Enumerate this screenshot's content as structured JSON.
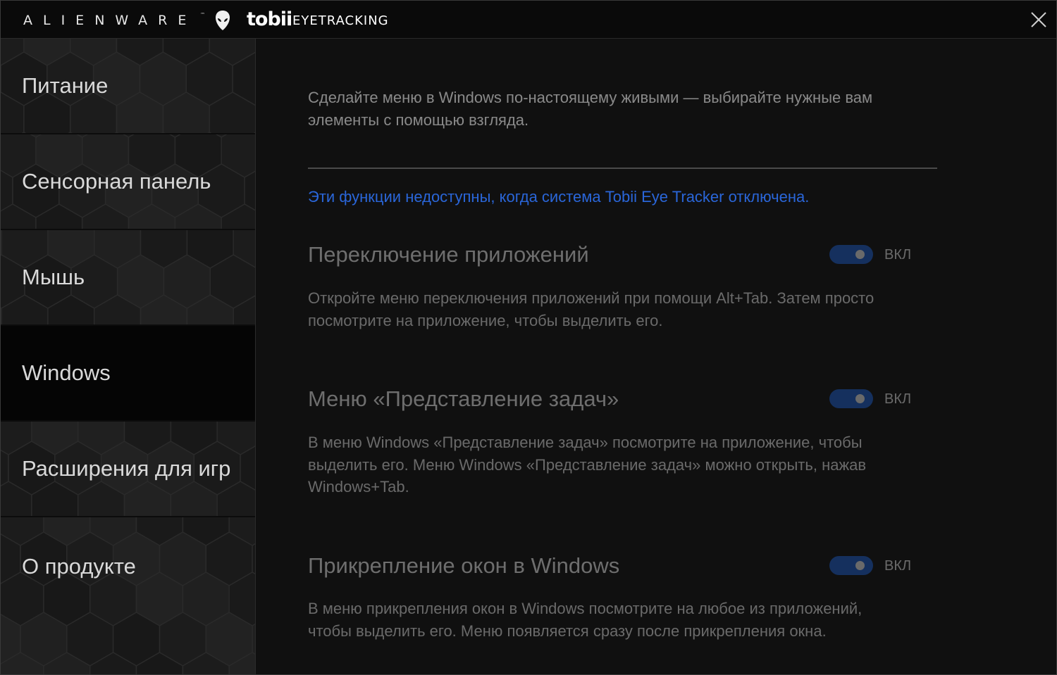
{
  "titlebar": {
    "brand_alienware": "ALIENWARE",
    "brand_tm": "™",
    "brand_tobii": "tobii",
    "brand_eyetracking": "EYETRACKING",
    "close_icon": "close-icon"
  },
  "sidebar": {
    "items": [
      {
        "label": "Питание"
      },
      {
        "label": "Сенсорная панель"
      },
      {
        "label": "Мышь"
      },
      {
        "label": "Windows"
      },
      {
        "label": "Расширения для игр"
      },
      {
        "label": "О продукте"
      }
    ],
    "active_index": 3
  },
  "main": {
    "intro": "Сделайте меню в Windows по-настоящему живыми — выбирайте нужные вам элементы с помощью взгляда.",
    "notice": "Эти функции недоступны, когда система Tobii Eye Tracker отключена.",
    "features": [
      {
        "title": "Переключение приложений",
        "toggle_label": "ВКЛ",
        "toggle_on": true,
        "description": "Откройте меню переключения приложений при помощи Alt+Tab. Затем просто посмотрите на приложение, чтобы выделить его."
      },
      {
        "title": "Меню «Представление задач»",
        "toggle_label": "ВКЛ",
        "toggle_on": true,
        "description": "В меню Windows «Представление задач» посмотрите на приложение, чтобы выделить его. Меню Windows «Представление задач» можно открыть, нажав Windows+Tab."
      },
      {
        "title": "Прикрепление окон в Windows",
        "toggle_label": "ВКЛ",
        "toggle_on": true,
        "description": "В меню прикрепления окон в Windows посмотрите на любое из приложений, чтобы выделить его. Меню появляется сразу после прикрепления окна."
      }
    ]
  },
  "colors": {
    "notice": "#2a66d9",
    "toggle_track": "#15305e"
  }
}
